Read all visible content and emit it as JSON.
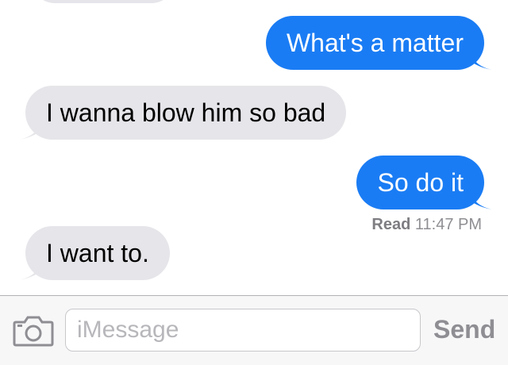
{
  "thread": {
    "messages": [
      {
        "direction": "outgoing",
        "text": "What's a matter"
      },
      {
        "direction": "incoming",
        "text": "I wanna blow him so bad"
      },
      {
        "direction": "outgoing",
        "text": "So do it"
      },
      {
        "direction": "incoming",
        "text": "I want to."
      }
    ],
    "read_receipt": {
      "label": "Read",
      "time": "11:47 PM"
    }
  },
  "input_bar": {
    "camera_icon": "camera-icon",
    "placeholder": "iMessage",
    "send_label": "Send"
  },
  "colors": {
    "outgoing_bubble": "#1a7cf4",
    "incoming_bubble": "#e5e5ea",
    "send_disabled": "#8e8e93"
  }
}
